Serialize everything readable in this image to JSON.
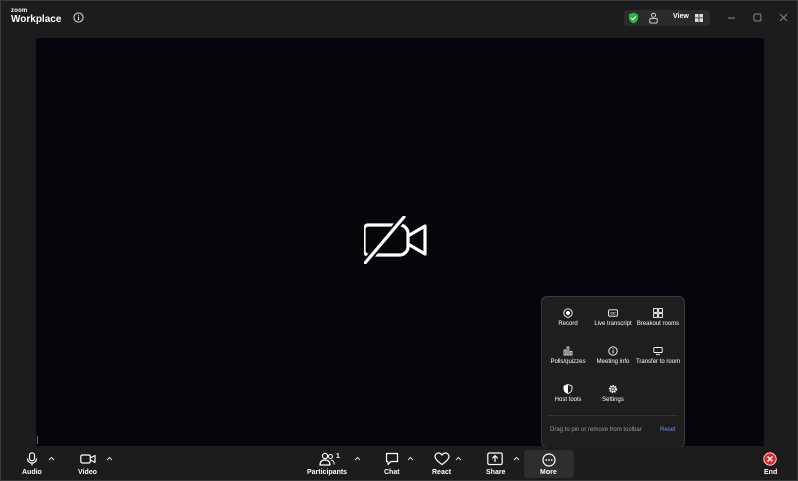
{
  "titlebar": {
    "brand_small": "zoom",
    "brand_big": "Workplace",
    "view_label": "View"
  },
  "more_menu": {
    "items": [
      {
        "label": "Record",
        "icon": "record-icon"
      },
      {
        "label": "Live transcript",
        "icon": "cc-icon"
      },
      {
        "label": "Breakout rooms",
        "icon": "breakout-icon"
      },
      {
        "label": "Polls/quizzes",
        "icon": "poll-icon"
      },
      {
        "label": "Meeting info",
        "icon": "info-icon"
      },
      {
        "label": "Transfer to room",
        "icon": "transfer-icon"
      },
      {
        "label": "Host tools",
        "icon": "host-shield-icon"
      },
      {
        "label": "Settings",
        "icon": "gear-icon"
      }
    ],
    "hint": "Drag to pin or remove from toolbar",
    "reset_label": "Reset"
  },
  "toolbar": {
    "audio_label": "Audio",
    "video_label": "Video",
    "participants_label": "Participants",
    "participants_count": "1",
    "chat_label": "Chat",
    "react_label": "React",
    "share_label": "Share",
    "more_label": "More",
    "end_label": "End"
  },
  "colors": {
    "video_bg": "#05050b",
    "shield_green": "#2bb44a",
    "end_red": "#e02828",
    "reset_blue": "#5a9bf5"
  }
}
